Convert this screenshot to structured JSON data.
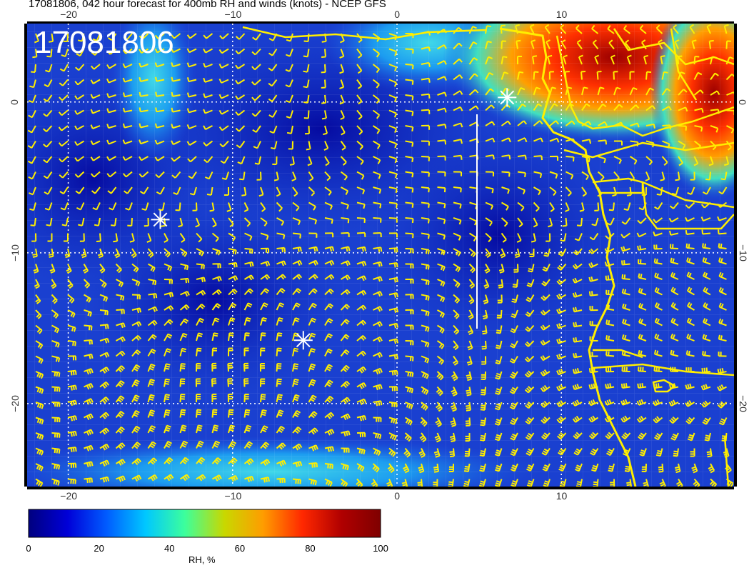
{
  "title": "17081806, 042 hour forecast for 400mb RH and winds (knots) - NCEP GFS",
  "stamp": "17081806",
  "lon_ticks": [
    {
      "value": -20,
      "label": "−20"
    },
    {
      "value": -10,
      "label": "−10"
    },
    {
      "value": 0,
      "label": "0"
    },
    {
      "value": 10,
      "label": "10"
    }
  ],
  "lat_ticks": [
    {
      "value": 0,
      "label": "0"
    },
    {
      "value": -10,
      "label": "−10"
    },
    {
      "value": -20,
      "label": "−20"
    }
  ],
  "map_extent": {
    "lon_min": -22.5,
    "lon_max": 20.5,
    "lat_min": -25.5,
    "lat_max": 5.2
  },
  "colorbar": {
    "label": "RH, %",
    "ticks": [
      {
        "value": 0,
        "label": "0"
      },
      {
        "value": 20,
        "label": "20"
      },
      {
        "value": 40,
        "label": "40"
      },
      {
        "value": 60,
        "label": "60"
      },
      {
        "value": 80,
        "label": "80"
      },
      {
        "value": 100,
        "label": "100"
      }
    ],
    "colors": [
      "#00007f",
      "#0000d8",
      "#005cff",
      "#00c8ff",
      "#3cff9c",
      "#c8d800",
      "#ff9c00",
      "#ff2800",
      "#b00000",
      "#7f0000"
    ]
  },
  "markers": [
    {
      "name": "marker-a",
      "lon": -14.4,
      "lat": -7.8
    },
    {
      "name": "marker-b",
      "lon": -5.7,
      "lat": -15.8
    },
    {
      "name": "marker-c",
      "lon": 6.7,
      "lat": 0.3
    }
  ],
  "colors": {
    "barb": "#ffee00",
    "coast": "#ffee00",
    "ocean": "#1436c8",
    "moist": "#d81c00"
  }
}
